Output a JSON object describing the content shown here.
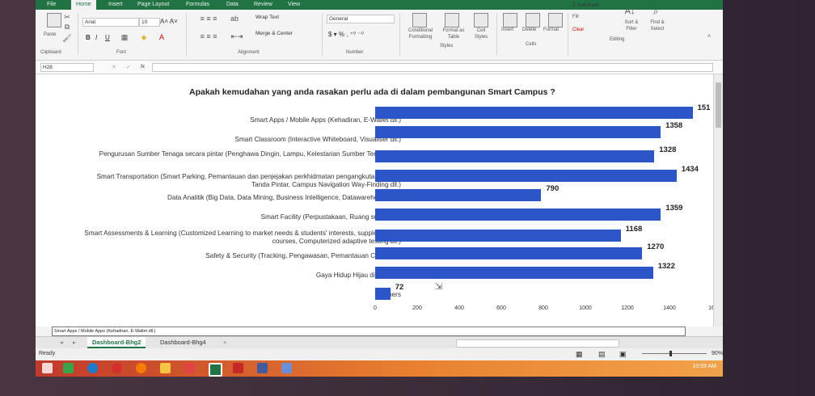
{
  "ribbon": {
    "tabs": [
      "File",
      "Home",
      "Insert",
      "Page Layout",
      "Formulas",
      "Data",
      "Review",
      "View"
    ],
    "font_name": "Arial",
    "font_size": "10",
    "wrap_text": "Wrap Text",
    "merge_center": "Merge & Center",
    "number_format": "General",
    "paste": "Paste",
    "conditional_formatting": "Conditional Formatting",
    "format_as_table": "Format as Table",
    "cell_styles": "Cell Styles",
    "insert": "Insert",
    "delete": "Delete",
    "format": "Format",
    "autosum": "AutoSum",
    "fill": "Fill",
    "clear": "Clear",
    "sort_filter": "Sort & Filter",
    "find_select": "Find & Select",
    "groups": {
      "clipboard": "Clipboard",
      "font": "Font",
      "alignment": "Alignment",
      "number": "Number",
      "styles": "Styles",
      "cells": "Cells",
      "editing": "Editing"
    }
  },
  "formula_bar": {
    "name_box": "H28",
    "fx": "fx",
    "content": ""
  },
  "chart_data": {
    "type": "bar",
    "title": "Apakah kemudahan yang anda rasakan perlu ada di dalam pembangunan Smart Campus ?",
    "categories": [
      "Smart Apps / Mobile Apps (Kehadiran, E-Wallet dll.)",
      "Smart Classroom (Interactive Whiteboard, Visualiser dll.)",
      "Pengurusan Sumber Tenaga secara pintar (Penghawa Dingin, Lampu, Kelestarian Sumber Tenaga dll.)",
      "Smart Transportation (Smart Parking, Pemantauan dan penjejakan perkhidmatan pengangkutan, Papan Tanda Pintar, Campus Navigation Way-Finding dll.)",
      "Data Analitik (Big Data, Data Mining, Business Intelligence, Datawarehouse dll.)",
      "Smart Facility (Perpustakaan, Ruang sukan dll.)",
      "Smart Assessments & Learning (Customized Learning to market needs & students' interests, supplementary courses, Computerized adaptive testing dll.)",
      "Safety & Security (Tracking, Pengawasan, Pemantauan CCTV dll.)",
      "Gaya Hidup Hijau di Kampus",
      "Others"
    ],
    "values": [
      1510,
      1358,
      1328,
      1434,
      790,
      1359,
      1168,
      1270,
      1322,
      72
    ],
    "value_labels": [
      "151",
      "1358",
      "1328",
      "1434",
      "790",
      "1359",
      "1168",
      "1270",
      "1322",
      "72"
    ],
    "xlim": [
      0,
      1600
    ],
    "xticks": [
      "0",
      "200",
      "400",
      "600",
      "800",
      "1000",
      "1200",
      "1400",
      "16"
    ],
    "bar_color": "#2c55c7"
  },
  "legend_strip": "Smart Apps / Mobile Apps (Kehadiran, E-Wallet dll.)",
  "sheet_tabs": [
    "Dashboard-Bhg2",
    "Dashboard-Bhg4"
  ],
  "status": {
    "ready": "Ready",
    "zoom": "90%"
  },
  "taskbar": {
    "time": "10:59 AM"
  }
}
